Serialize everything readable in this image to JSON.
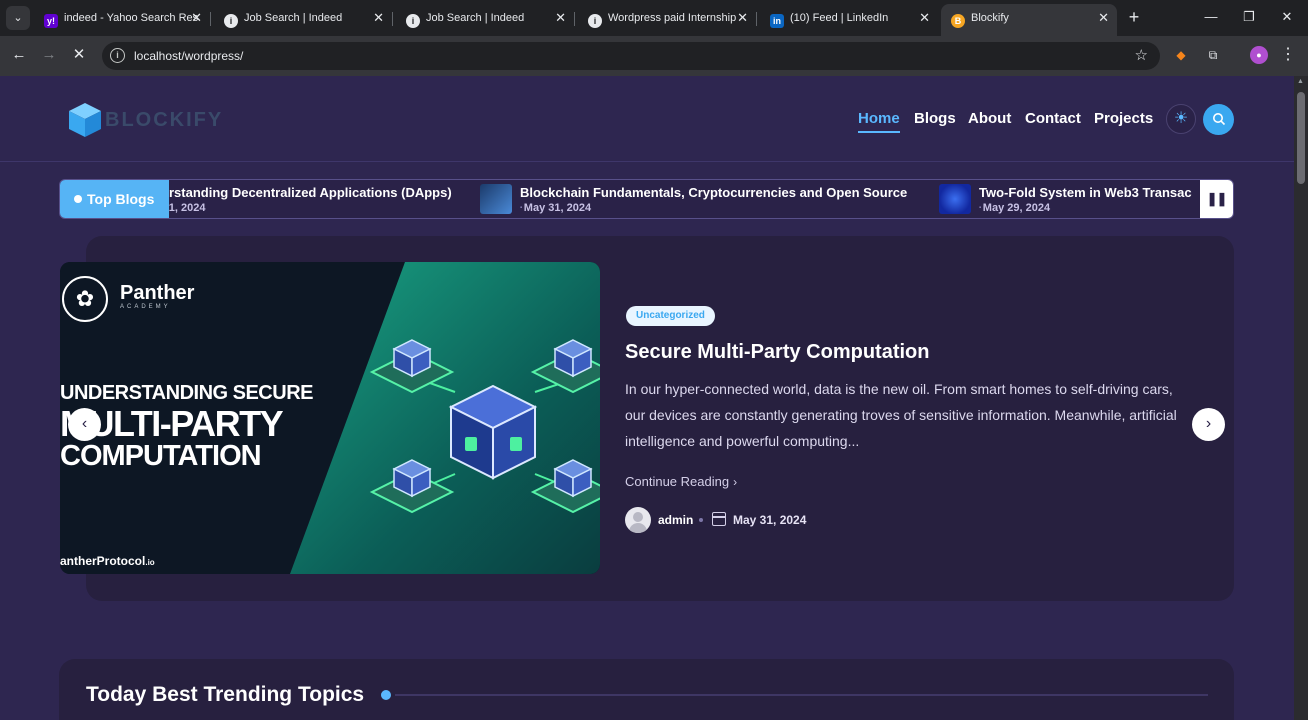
{
  "browser": {
    "tabs": [
      {
        "title": "indeed - Yahoo Search Res",
        "fav": "y!",
        "color": "#6001d2"
      },
      {
        "title": "Job Search | Indeed",
        "fav": "i",
        "color": "#e8eaed"
      },
      {
        "title": "Job Search | Indeed",
        "fav": "i",
        "color": "#e8eaed"
      },
      {
        "title": "Wordpress paid Internship",
        "fav": "i",
        "color": "#e8eaed"
      },
      {
        "title": "(10) Feed | LinkedIn",
        "fav": "in",
        "color": "#0a66c2"
      },
      {
        "title": "Blockify",
        "fav": "B",
        "color": "#f6a623"
      }
    ],
    "url": "localhost/wordpress/"
  },
  "site": {
    "logo": "BLOCKIFY",
    "nav": [
      "Home",
      "Blogs",
      "About",
      "Contact",
      "Projects"
    ]
  },
  "ticker": {
    "badge": "Top Blogs",
    "items": [
      {
        "title": "rstanding Decentralized Applications (DApps)",
        "date": "1, 2024"
      },
      {
        "title": "Blockchain Fundamentals, Cryptocurrencies and Open Source",
        "date": "May 31, 2024"
      },
      {
        "title": "Two-Fold System in Web3 Transac",
        "date": "May 29, 2024"
      }
    ]
  },
  "hero": {
    "image": {
      "brand": "Panther",
      "brand_sub": "ACADEMY",
      "line1": "UNDERSTANDING SECURE",
      "line2": "MULTI-PARTY",
      "line3": "COMPUTATION",
      "footer": "antherProtocol",
      "footer_suffix": ".io"
    },
    "category": "Uncategorized",
    "title": "Secure Multi-Party Computation",
    "excerpt": "In our hyper-connected world, data is the new oil. From smart homes to self-driving cars, our devices are constantly generating troves of sensitive information. Meanwhile, artificial intelligence and powerful computing...",
    "continue_label": "Continue Reading",
    "author": "admin",
    "date": "May 31, 2024"
  },
  "trending": {
    "title": "Today Best Trending Topics"
  }
}
